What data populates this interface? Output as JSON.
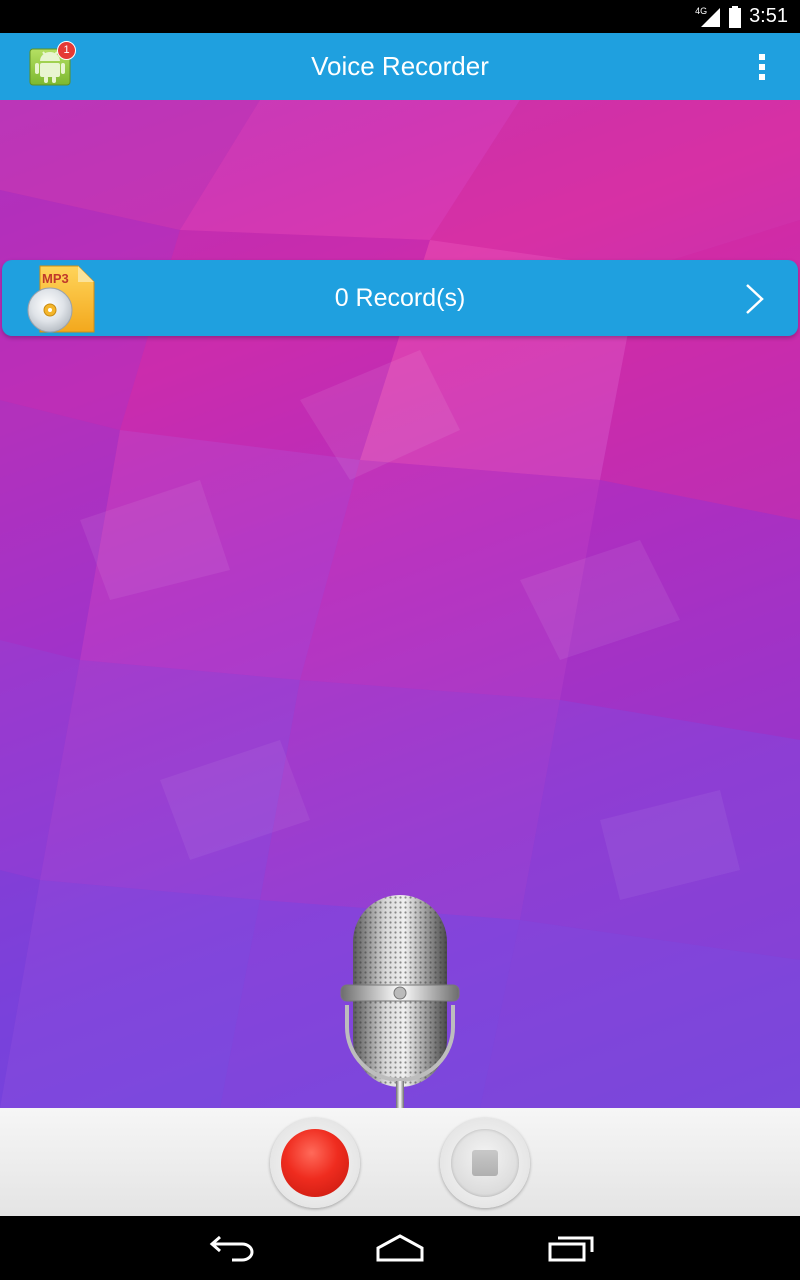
{
  "status_bar": {
    "network": "4G",
    "time": "3:51",
    "icons": [
      "signal-icon",
      "battery-icon"
    ]
  },
  "action_bar": {
    "title": "Voice Recorder",
    "notification_count": "1",
    "icons": [
      "app-icon",
      "overflow-menu-icon"
    ],
    "color": "#1fa0df"
  },
  "records": {
    "label": "0 Record(s)",
    "file_badge": "MP3",
    "icons": [
      "mp3-file-icon",
      "chevron-right-icon"
    ]
  },
  "controls": {
    "icons": [
      "microphone-icon",
      "record-button",
      "stop-button"
    ],
    "record_color": "#ef2c1f"
  },
  "nav_bar": {
    "icons": [
      "back-icon",
      "home-icon",
      "recent-apps-icon"
    ]
  }
}
